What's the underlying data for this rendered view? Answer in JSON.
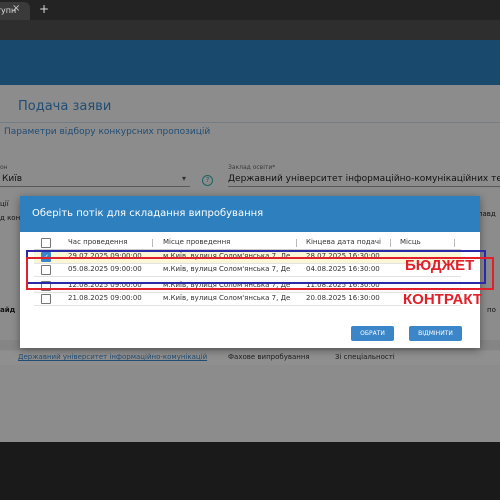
{
  "browser": {
    "tab_title": "ступн",
    "tab_close": "×",
    "new_tab": "+"
  },
  "page": {
    "title": "Подача заяви",
    "subtitle": "Параметри відбору конкурсних пропозицій",
    "field_left": {
      "label": "он",
      "value": "Київ"
    },
    "field_right": {
      "label": "Заклад освіти*",
      "value": "Державний університет інформаційно-комунікаційних технологій"
    },
    "help_icon": "?",
    "partial_left_1": "ції",
    "partial_left_2": "д кон",
    "partial_left_3": "айд",
    "partial_right_1": "лавд",
    "partial_right_2": "по"
  },
  "modal": {
    "title": "Оберіть потік для складання випробування",
    "columns": [
      "Час проведення",
      "Місце проведення",
      "Кінцева дата подачі",
      "Місць"
    ],
    "rows": [
      {
        "checked": true,
        "time": "29.07.2025 09:00:00",
        "place": "м.Київ, вулиця Солом'янська 7, Держ",
        "deadline": "28.07.2025 16:30:00",
        "seats": ""
      },
      {
        "checked": false,
        "time": "05.08.2025 09:00:00",
        "place": "м.Київ, вулиця Солом'янська 7, Держ",
        "deadline": "04.08.2025 16:30:00",
        "seats": ""
      },
      {
        "checked": false,
        "time": "12.08.2025 09:00:00",
        "place": "м.Київ, вулиця Солом'янська 7, Держ",
        "deadline": "11.08.2025 16:30:00",
        "seats": ""
      },
      {
        "checked": false,
        "time": "21.08.2025 09:00:00",
        "place": "м.Київ, вулиця Солом'янська 7, Держ",
        "deadline": "20.08.2025 16:30:00",
        "seats": ""
      }
    ],
    "buttons": {
      "choose": "ОБРАТИ",
      "cancel": "ВІДМІНИТИ"
    }
  },
  "annotations": {
    "budget": "БЮДЖЕТ",
    "contract": "КОНТРАКТ",
    "budget_color": "#2a2aa8",
    "contract_color": "#e0202a"
  },
  "bottom_table": {
    "row": {
      "university": "Державний університет інформаційно-комунікацій",
      "exam": "Фахове випробування",
      "spec": "Зі спеціальності"
    }
  },
  "colors": {
    "primary": "#2d7fbd",
    "accent": "#3a86c8"
  }
}
